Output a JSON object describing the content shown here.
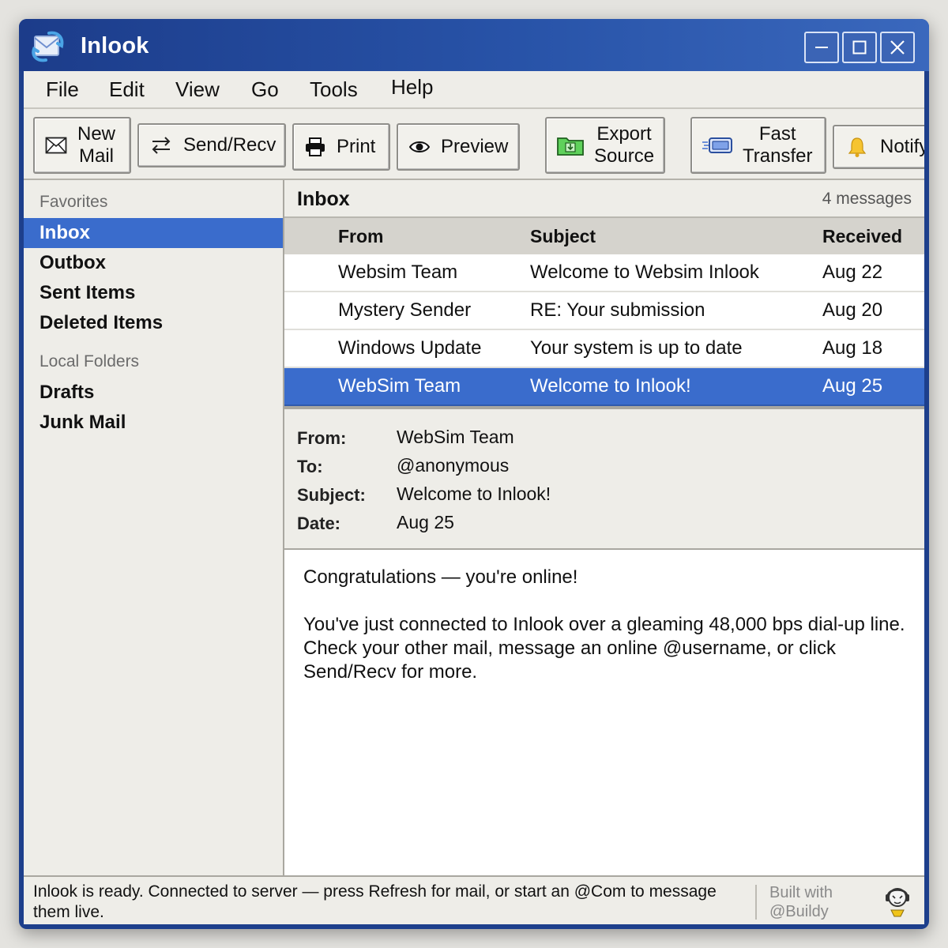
{
  "window": {
    "title": "Inlook"
  },
  "menu": [
    "File",
    "Edit",
    "View",
    "Go",
    "Tools",
    "Help"
  ],
  "toolbar": {
    "new_mail": [
      "New",
      "Mail"
    ],
    "send_recv": "Send/Recv",
    "print": "Print",
    "preview": "Preview",
    "export_source": [
      "Export",
      "Source"
    ],
    "fast_transfer": [
      "Fast",
      "Transfer"
    ],
    "notify": "Notify"
  },
  "sidebar": {
    "favorites_label": "Favorites",
    "favorites": [
      "Inbox",
      "Outbox",
      "Sent Items",
      "Deleted Items"
    ],
    "local_label": "Local Folders",
    "local": [
      "Drafts",
      "Junk Mail"
    ],
    "active": "Inbox"
  },
  "inbox": {
    "title": "Inbox",
    "count": "4 messages",
    "columns": {
      "from": "From",
      "subject": "Subject",
      "received": "Received"
    },
    "messages": [
      {
        "from": "Websim Team",
        "subject": "Welcome to Websim Inlook",
        "received": "Aug 22"
      },
      {
        "from": "Mystery Sender",
        "subject": "RE: Your submission",
        "received": "Aug 20"
      },
      {
        "from": "Windows Update",
        "subject": "Your system is up to date",
        "received": "Aug 18"
      },
      {
        "from": "WebSim Team",
        "subject": "Welcome to Inlook!",
        "received": "Aug 25"
      }
    ]
  },
  "preview": {
    "labels": {
      "from": "From:",
      "to": "To:",
      "subject": "Subject:",
      "date": "Date:"
    },
    "from": "WebSim Team",
    "to": "@anonymous",
    "subject": "Welcome to Inlook!",
    "date": "Aug 25",
    "body_line1": "Congratulations — you're online!",
    "body_line2": "You've just connected to Inlook over a gleaming 48,000 bps dial-up line. Check your other mail, message an online @username, or click Send/Recv for more."
  },
  "status": {
    "text": "Inlook is ready. Connected to server — press Refresh for mail, or start an @Com to message them live.",
    "built_line1": "Built with",
    "built_line2": "@Buildy"
  },
  "colors": {
    "title_bar": "#1c3c8a",
    "selection": "#3a6ccc",
    "window_bg": "#eeede8"
  }
}
